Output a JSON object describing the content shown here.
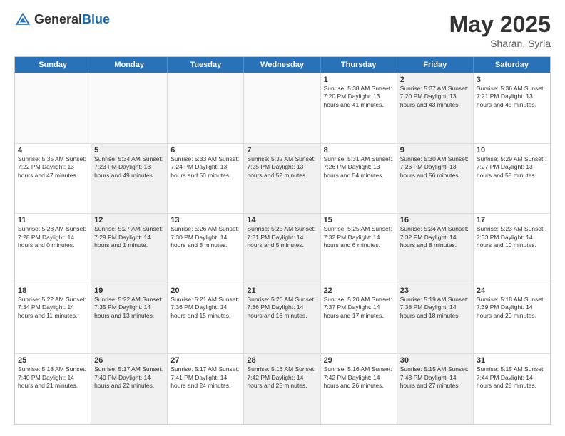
{
  "header": {
    "logo_general": "General",
    "logo_blue": "Blue",
    "month_title": "May 2025",
    "subtitle": "Sharan, Syria"
  },
  "days_of_week": [
    "Sunday",
    "Monday",
    "Tuesday",
    "Wednesday",
    "Thursday",
    "Friday",
    "Saturday"
  ],
  "rows": [
    [
      {
        "day": "",
        "text": "",
        "empty": true
      },
      {
        "day": "",
        "text": "",
        "empty": true
      },
      {
        "day": "",
        "text": "",
        "empty": true
      },
      {
        "day": "",
        "text": "",
        "empty": true
      },
      {
        "day": "1",
        "text": "Sunrise: 5:38 AM\nSunset: 7:20 PM\nDaylight: 13 hours\nand 41 minutes."
      },
      {
        "day": "2",
        "text": "Sunrise: 5:37 AM\nSunset: 7:20 PM\nDaylight: 13 hours\nand 43 minutes.",
        "shaded": true
      },
      {
        "day": "3",
        "text": "Sunrise: 5:36 AM\nSunset: 7:21 PM\nDaylight: 13 hours\nand 45 minutes."
      }
    ],
    [
      {
        "day": "4",
        "text": "Sunrise: 5:35 AM\nSunset: 7:22 PM\nDaylight: 13 hours\nand 47 minutes."
      },
      {
        "day": "5",
        "text": "Sunrise: 5:34 AM\nSunset: 7:23 PM\nDaylight: 13 hours\nand 49 minutes.",
        "shaded": true
      },
      {
        "day": "6",
        "text": "Sunrise: 5:33 AM\nSunset: 7:24 PM\nDaylight: 13 hours\nand 50 minutes."
      },
      {
        "day": "7",
        "text": "Sunrise: 5:32 AM\nSunset: 7:25 PM\nDaylight: 13 hours\nand 52 minutes.",
        "shaded": true
      },
      {
        "day": "8",
        "text": "Sunrise: 5:31 AM\nSunset: 7:26 PM\nDaylight: 13 hours\nand 54 minutes."
      },
      {
        "day": "9",
        "text": "Sunrise: 5:30 AM\nSunset: 7:26 PM\nDaylight: 13 hours\nand 56 minutes.",
        "shaded": true
      },
      {
        "day": "10",
        "text": "Sunrise: 5:29 AM\nSunset: 7:27 PM\nDaylight: 13 hours\nand 58 minutes."
      }
    ],
    [
      {
        "day": "11",
        "text": "Sunrise: 5:28 AM\nSunset: 7:28 PM\nDaylight: 14 hours\nand 0 minutes."
      },
      {
        "day": "12",
        "text": "Sunrise: 5:27 AM\nSunset: 7:29 PM\nDaylight: 14 hours\nand 1 minute.",
        "shaded": true
      },
      {
        "day": "13",
        "text": "Sunrise: 5:26 AM\nSunset: 7:30 PM\nDaylight: 14 hours\nand 3 minutes."
      },
      {
        "day": "14",
        "text": "Sunrise: 5:25 AM\nSunset: 7:31 PM\nDaylight: 14 hours\nand 5 minutes.",
        "shaded": true
      },
      {
        "day": "15",
        "text": "Sunrise: 5:25 AM\nSunset: 7:32 PM\nDaylight: 14 hours\nand 6 minutes."
      },
      {
        "day": "16",
        "text": "Sunrise: 5:24 AM\nSunset: 7:32 PM\nDaylight: 14 hours\nand 8 minutes.",
        "shaded": true
      },
      {
        "day": "17",
        "text": "Sunrise: 5:23 AM\nSunset: 7:33 PM\nDaylight: 14 hours\nand 10 minutes."
      }
    ],
    [
      {
        "day": "18",
        "text": "Sunrise: 5:22 AM\nSunset: 7:34 PM\nDaylight: 14 hours\nand 11 minutes."
      },
      {
        "day": "19",
        "text": "Sunrise: 5:22 AM\nSunset: 7:35 PM\nDaylight: 14 hours\nand 13 minutes.",
        "shaded": true
      },
      {
        "day": "20",
        "text": "Sunrise: 5:21 AM\nSunset: 7:36 PM\nDaylight: 14 hours\nand 15 minutes."
      },
      {
        "day": "21",
        "text": "Sunrise: 5:20 AM\nSunset: 7:36 PM\nDaylight: 14 hours\nand 16 minutes.",
        "shaded": true
      },
      {
        "day": "22",
        "text": "Sunrise: 5:20 AM\nSunset: 7:37 PM\nDaylight: 14 hours\nand 17 minutes."
      },
      {
        "day": "23",
        "text": "Sunrise: 5:19 AM\nSunset: 7:38 PM\nDaylight: 14 hours\nand 18 minutes.",
        "shaded": true
      },
      {
        "day": "24",
        "text": "Sunrise: 5:18 AM\nSunset: 7:39 PM\nDaylight: 14 hours\nand 20 minutes."
      }
    ],
    [
      {
        "day": "25",
        "text": "Sunrise: 5:18 AM\nSunset: 7:40 PM\nDaylight: 14 hours\nand 21 minutes."
      },
      {
        "day": "26",
        "text": "Sunrise: 5:17 AM\nSunset: 7:40 PM\nDaylight: 14 hours\nand 22 minutes.",
        "shaded": true
      },
      {
        "day": "27",
        "text": "Sunrise: 5:17 AM\nSunset: 7:41 PM\nDaylight: 14 hours\nand 24 minutes."
      },
      {
        "day": "28",
        "text": "Sunrise: 5:16 AM\nSunset: 7:42 PM\nDaylight: 14 hours\nand 25 minutes.",
        "shaded": true
      },
      {
        "day": "29",
        "text": "Sunrise: 5:16 AM\nSunset: 7:42 PM\nDaylight: 14 hours\nand 26 minutes."
      },
      {
        "day": "30",
        "text": "Sunrise: 5:15 AM\nSunset: 7:43 PM\nDaylight: 14 hours\nand 27 minutes.",
        "shaded": true
      },
      {
        "day": "31",
        "text": "Sunrise: 5:15 AM\nSunset: 7:44 PM\nDaylight: 14 hours\nand 28 minutes."
      }
    ]
  ]
}
